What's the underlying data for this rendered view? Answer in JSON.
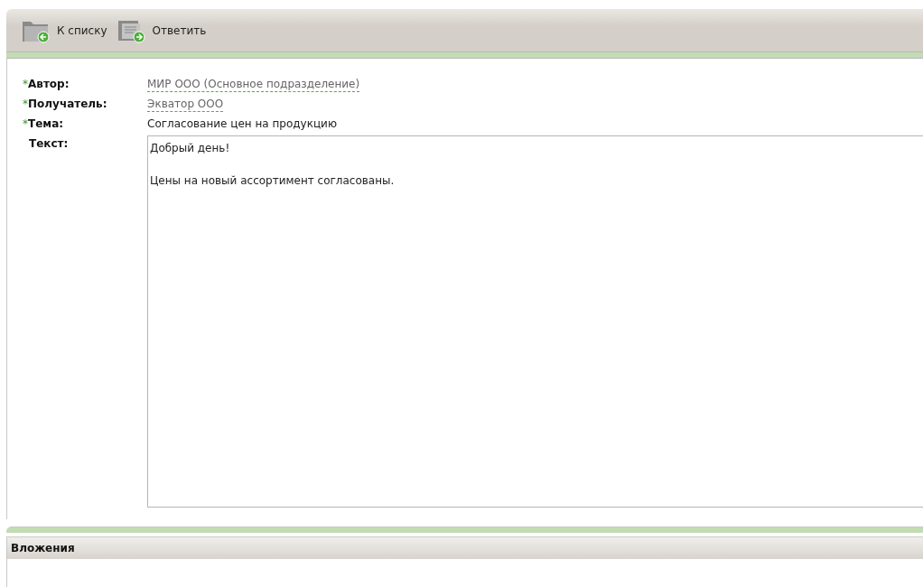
{
  "toolbar": {
    "buttons": [
      {
        "label": "К списку",
        "kind": "folder"
      },
      {
        "label": "Ответить",
        "kind": "message"
      }
    ]
  },
  "form": {
    "fields": [
      {
        "mark": "*",
        "label": "Автор:",
        "kind": "link",
        "value": "МИР ООО (Основное подразделение)"
      },
      {
        "mark": "*",
        "label": "Получатель:",
        "kind": "link",
        "value": "Экватор ООО"
      },
      {
        "mark": "*",
        "label": "Тема:",
        "kind": "text",
        "value": "Согласование цен на продукцию"
      },
      {
        "label": "Текст:",
        "kind": "textarea",
        "paragraphs": [
          "Добрый день!",
          "Цены на новый ассортимент согласованы."
        ]
      }
    ]
  },
  "attachments": {
    "title": "Вложения"
  }
}
